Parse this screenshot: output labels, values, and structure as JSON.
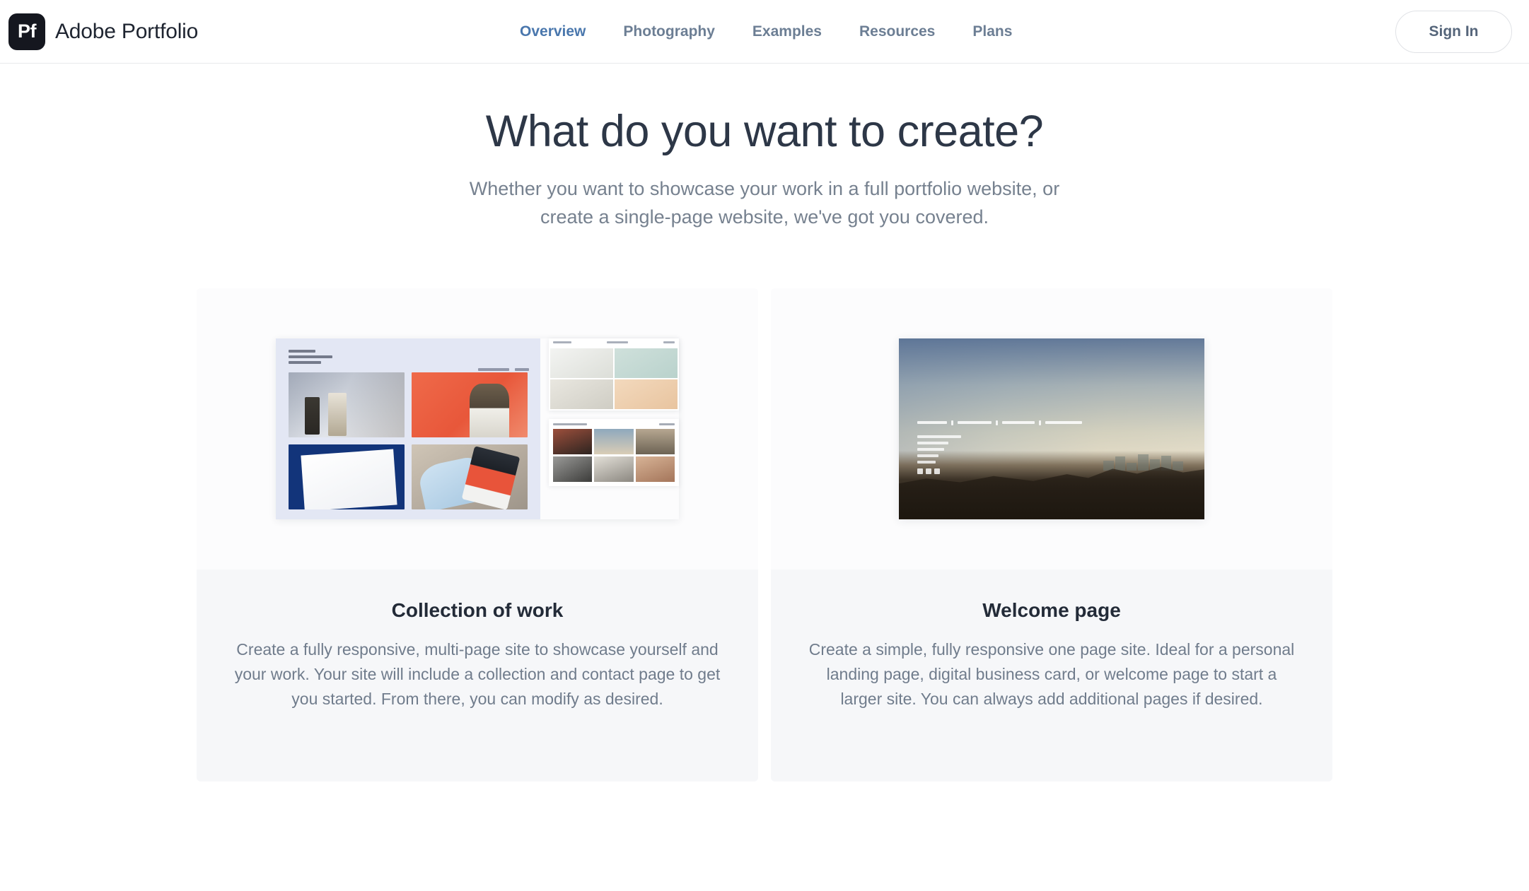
{
  "header": {
    "logo_text": "Pf",
    "logo_icon": "adobe-portfolio-logo-icon",
    "brand_name": "Adobe Portfolio",
    "nav_items": [
      {
        "label": "Overview",
        "active": true
      },
      {
        "label": "Photography",
        "active": false
      },
      {
        "label": "Examples",
        "active": false
      },
      {
        "label": "Resources",
        "active": false
      },
      {
        "label": "Plans",
        "active": false
      }
    ],
    "sign_in_label": "Sign In"
  },
  "hero": {
    "title": "What do you want to create?",
    "subtitle_line1": "Whether you want to showcase your work in a full portfolio website, or",
    "subtitle_line2": "create a single-page website, we've got you covered."
  },
  "cards": [
    {
      "title": "Collection of work",
      "description": "Create a fully responsive, multi-page site to showcase yourself and your work. Your site will include a collection and contact page to get you started. From there, you can modify as desired.",
      "preview": "multi-page-portfolio-grid-preview"
    },
    {
      "title": "Welcome page",
      "description": "Create a simple, fully responsive one page site. Ideal for a personal landing page, digital business card, or welcome page to start a larger site. You can always add additional pages if desired.",
      "preview": "single-page-landing-photo-preview"
    }
  ],
  "colors": {
    "page_background": "#ffffff",
    "nav_active": "#4a77ad",
    "nav_inactive": "#6c7e94",
    "heading": "#2d3747",
    "body_text": "#707c8c",
    "card_background": "#f6f7f9",
    "card_media_background": "#fcfcfd",
    "logo_background": "#15171f",
    "header_border": "#e8e9eb",
    "accent_orange": "#e8573a",
    "accent_navy": "#12347a"
  }
}
